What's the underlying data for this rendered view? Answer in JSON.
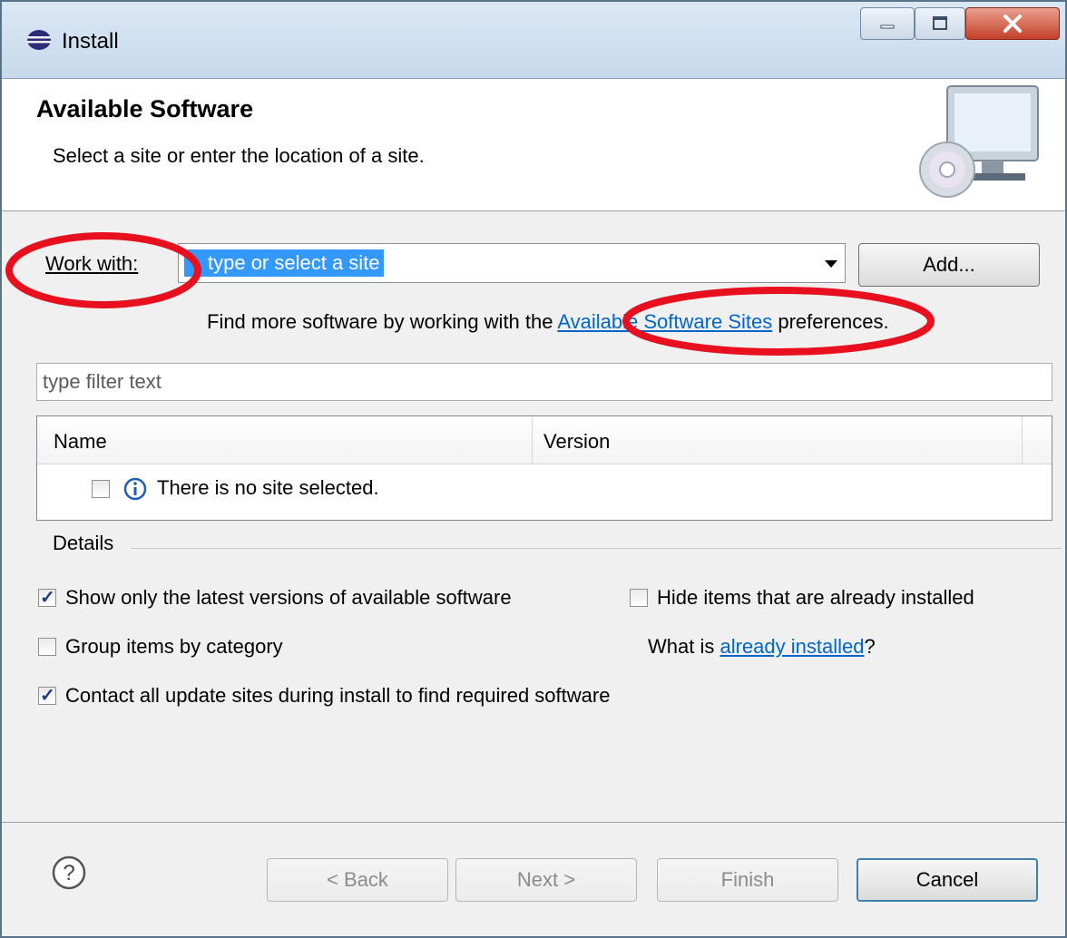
{
  "window": {
    "title": "Install"
  },
  "header": {
    "title": "Available Software",
    "description": "Select a site or enter the location of a site."
  },
  "work_with": {
    "label": "Work with:",
    "value": "type or select a site",
    "add_button": "Add..."
  },
  "find_more": {
    "prefix": "Find more software by working with the ",
    "link": "Available Software Sites",
    "suffix": " preferences."
  },
  "filter": {
    "placeholder": "type filter text"
  },
  "table": {
    "columns": [
      "Name",
      "Version"
    ],
    "rows": [
      {
        "name": "There is no site selected.",
        "version": "",
        "checked": false
      }
    ]
  },
  "details": {
    "label": "Details"
  },
  "options": {
    "show_latest": {
      "label": "Show only the latest versions of available software",
      "checked": true
    },
    "hide_installed": {
      "label": "Hide items that are already installed",
      "checked": false
    },
    "group_by_category": {
      "label": "Group items by category",
      "checked": false
    },
    "what_is_prefix": "What is ",
    "already_installed_link": "already installed",
    "what_is_suffix": "?",
    "contact_sites": {
      "label": "Contact all update sites during install to find required software",
      "checked": true
    }
  },
  "buttons": {
    "back": "< Back",
    "next": "Next >",
    "finish": "Finish",
    "cancel": "Cancel"
  },
  "annotations": {
    "highlight_color": "#e8101e"
  }
}
